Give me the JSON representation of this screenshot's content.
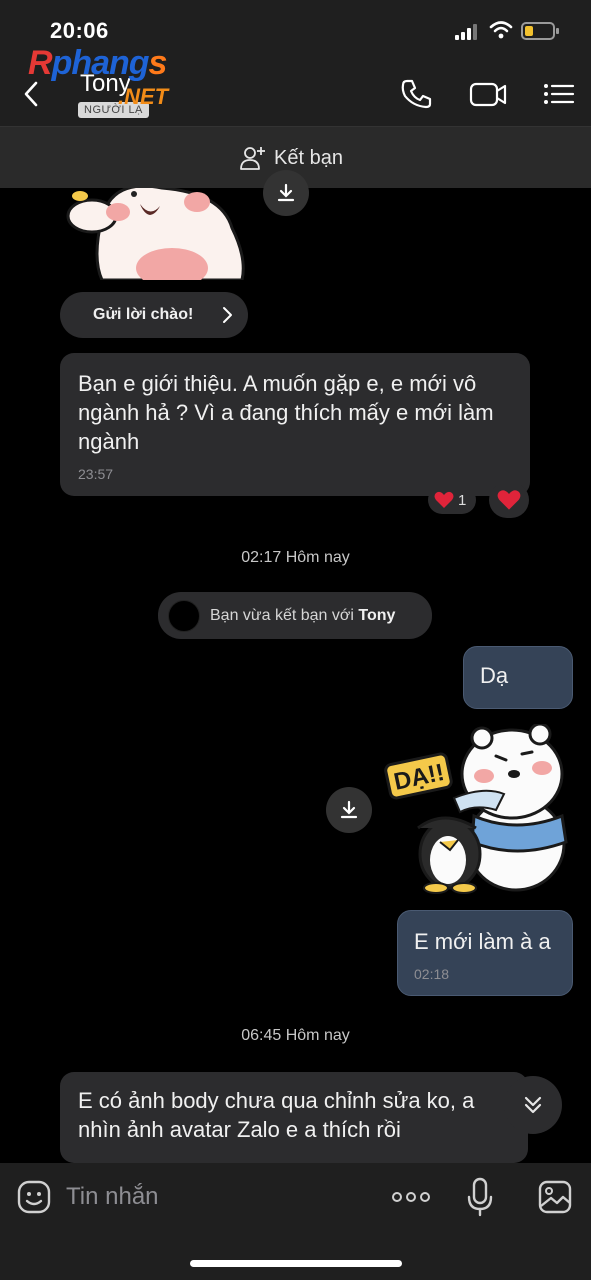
{
  "status_bar": {
    "time": "20:06"
  },
  "header": {
    "contact_name": "Tony",
    "badge": "NGƯỜI LẠ",
    "watermark_main_1": "R",
    "watermark_main_2": "phang",
    "watermark_main_3": "s",
    "watermark_net": ".NET"
  },
  "add_friend": {
    "label": "Kết bạn"
  },
  "conversation": {
    "greet_button": "Gửi lời chào!",
    "msg1": {
      "text": "Bạn e giới thiệu. A muốn gặp e, e mới vô ngành hả ? Vì a đang thích mấy e mới làm ngành",
      "time": "23:57",
      "reaction_count": "1"
    },
    "sep1": "02:17 Hôm nay",
    "system": {
      "prefix": "Bạn vừa kết bạn với ",
      "name": "Tony"
    },
    "msg2": {
      "text": "Dạ"
    },
    "sticker_text": "DẠ!!",
    "msg3": {
      "text": "E mới làm à a",
      "time": "02:18"
    },
    "sep2": "06:45 Hôm nay",
    "msg4": {
      "text": "E có ảnh body chưa qua chỉnh sửa ko, a nhìn ảnh avatar Zalo e a thích rồi"
    }
  },
  "input_bar": {
    "placeholder": "Tin nhắn"
  },
  "colors": {
    "incoming_bubble": "#2c2c2e",
    "outgoing_bubble": "#354357",
    "heart": "#e0243a"
  }
}
